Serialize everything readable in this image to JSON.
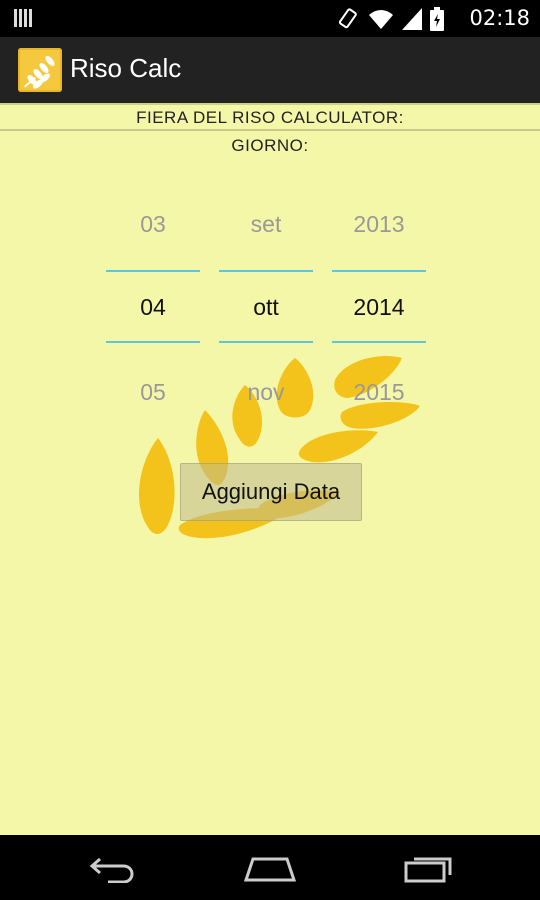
{
  "status_bar": {
    "time": "02:18",
    "icons": [
      "signal-bars-icon",
      "rotate-icon",
      "wifi-icon",
      "cell-signal-icon",
      "battery-icon"
    ]
  },
  "app": {
    "title": "Riso Calc",
    "icon": "wheat-icon"
  },
  "headings": {
    "title": "FIERA DEL RISO CALCULATOR:",
    "subtitle": "GIORNO:"
  },
  "date_picker": {
    "day": {
      "prev": "03",
      "current": "04",
      "next": "05"
    },
    "month": {
      "prev": "set",
      "current": "ott",
      "next": "nov"
    },
    "year": {
      "prev": "2013",
      "current": "2014",
      "next": "2015"
    }
  },
  "add_button_label": "Aggiungi Data",
  "nav_bar": {
    "icons": [
      "back-icon",
      "home-icon",
      "recents-icon"
    ]
  },
  "colors": {
    "background": "#f5f7a8",
    "accent_line": "#5fc6e0",
    "wheat": "#f3c31b"
  }
}
